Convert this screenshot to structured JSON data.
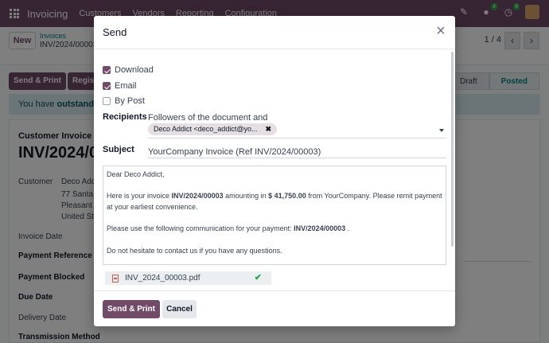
{
  "navbar": {
    "brand": "Invoicing",
    "menu": [
      "Customers",
      "Vendors",
      "Reporting",
      "Configuration"
    ],
    "badges": {
      "messages": "4",
      "activities": "8"
    },
    "icons": [
      "edit-icon",
      "chat-icon",
      "clock-icon"
    ]
  },
  "control_panel": {
    "new_label": "New",
    "breadcrumb_parent": "Invoices",
    "breadcrumb_current": "INV/2024/00003",
    "pager": "1 / 4"
  },
  "statusbar": {
    "send_print_label": "Send & Print",
    "register_label": "Regist",
    "stages": [
      "Draft",
      "Posted"
    ],
    "active_stage": "Posted"
  },
  "alert": {
    "prefix": "You have ",
    "bold": "outstanding"
  },
  "sheet": {
    "doc_type": "Customer Invoice",
    "doc_name": "INV/2024/0",
    "customer_label": "Customer",
    "customer_lines": [
      "Deco Add",
      "77 Santa",
      "Pleasant I",
      "United St"
    ],
    "fields": [
      "Invoice Date",
      "Payment Reference",
      "Payment Blocked",
      "Due Date",
      "Delivery Date",
      "Transmission Method"
    ]
  },
  "dialog": {
    "title": "Send",
    "options": [
      {
        "label": "Download",
        "checked": true
      },
      {
        "label": "Email",
        "checked": true
      },
      {
        "label": "By Post",
        "checked": false
      }
    ],
    "recipients_label": "Recipients",
    "recipients_intro": "Followers of the document and",
    "recipient_tag": "Deco Addict <deco_addict@yo...",
    "subject_label": "Subject",
    "subject_value": "YourCompany Invoice (Ref INV/2024/00003)",
    "body": {
      "greeting": "Dear Deco Addict,",
      "p1_a": "Here is your invoice ",
      "p1_invoice": "INV/2024/00003",
      "p1_b": " amounting in ",
      "p1_amount": "$ 41,750.00",
      "p1_c": " from YourCompany. Please remit payment at your earliest convenience.",
      "p2_a": "Please use the following communication for your payment: ",
      "p2_ref": "INV/2024/00003",
      "p2_b": " .",
      "p3": "Do not hesitate to contact us if you have any questions."
    },
    "attachment": "INV_2024_00003.pdf",
    "send_print_label": "Send & Print",
    "cancel_label": "Cancel"
  },
  "colors": {
    "brand": "#714b67",
    "teal": "#017e84",
    "success": "#28a745"
  }
}
